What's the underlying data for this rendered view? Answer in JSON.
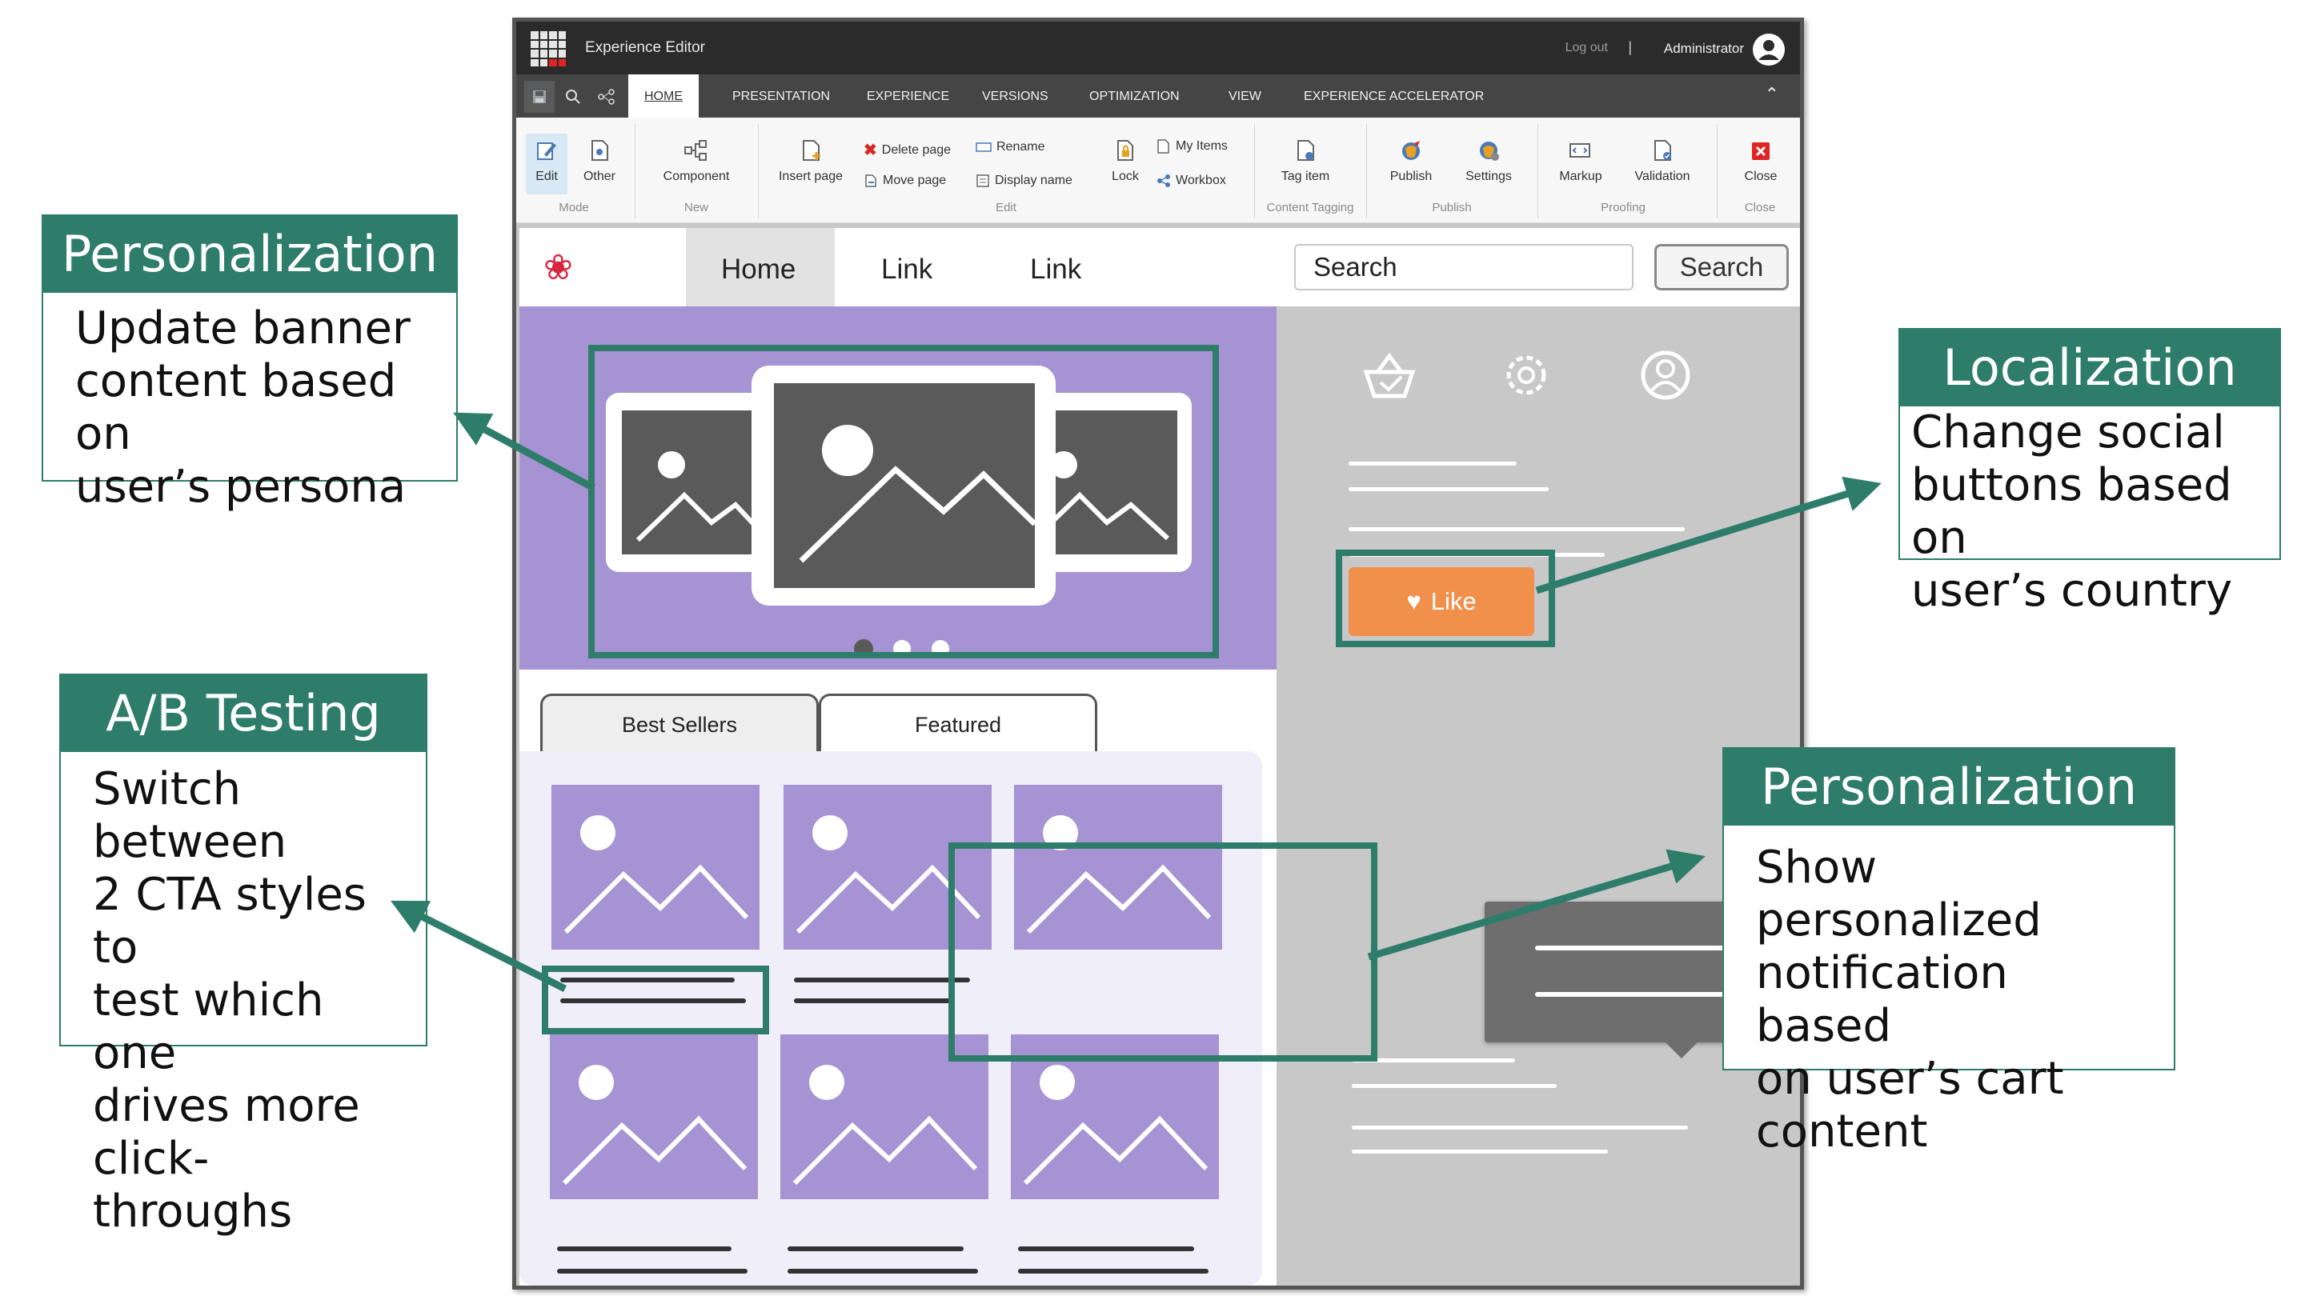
{
  "window": {
    "app_title": "Experience Editor",
    "logout_label": "Log out",
    "separator": "|",
    "user_name": "Administrator"
  },
  "tabs": [
    "HOME",
    "PRESENTATION",
    "EXPERIENCE",
    "VERSIONS",
    "OPTIMIZATION",
    "VIEW",
    "EXPERIENCE ACCELERATOR"
  ],
  "ribbon": {
    "edit": "Edit",
    "other": "Other",
    "component": "Component",
    "insert_page": "Insert page",
    "delete_page": "Delete page",
    "move_page": "Move page",
    "rename": "Rename",
    "display_name": "Display name",
    "lock": "Lock",
    "my_items": "My Items",
    "workbox": "Workbox",
    "tag_item": "Tag item",
    "publish": "Publish",
    "settings": "Settings",
    "markup": "Markup",
    "validation": "Validation",
    "close": "Close",
    "groups": {
      "mode": "Mode",
      "new": "New",
      "edit": "Edit",
      "content_tagging": "Content Tagging",
      "publish": "Publish",
      "proofing": "Proofing",
      "close": "Close"
    }
  },
  "site": {
    "nav_home": "Home",
    "nav_link1": "Link",
    "nav_link2": "Link",
    "search_value": "Search",
    "search_button": "Search",
    "tab_best_sellers": "Best Sellers",
    "tab_featured": "Featured",
    "like_label": "Like"
  },
  "callouts": {
    "personalization_banner": {
      "title": "Personalization",
      "lines": [
        "Update banner",
        "content based on",
        "user’s persona"
      ]
    },
    "ab_testing": {
      "title": "A/B Testing",
      "lines": [
        "Switch between",
        "2 CTA styles to",
        "test which one",
        "drives more",
        "click-throughs"
      ]
    },
    "localization": {
      "title": "Localization",
      "lines": [
        "Change social",
        "buttons based on",
        "user’s country"
      ]
    },
    "personalization_notification": {
      "title": "Personalization",
      "lines": [
        "Show personalized",
        "notification based",
        "on user’s cart",
        "content"
      ]
    }
  },
  "colors": {
    "accent_green": "#2e7d6a",
    "banner_purple": "#a693d3",
    "like_orange": "#f0904a"
  }
}
